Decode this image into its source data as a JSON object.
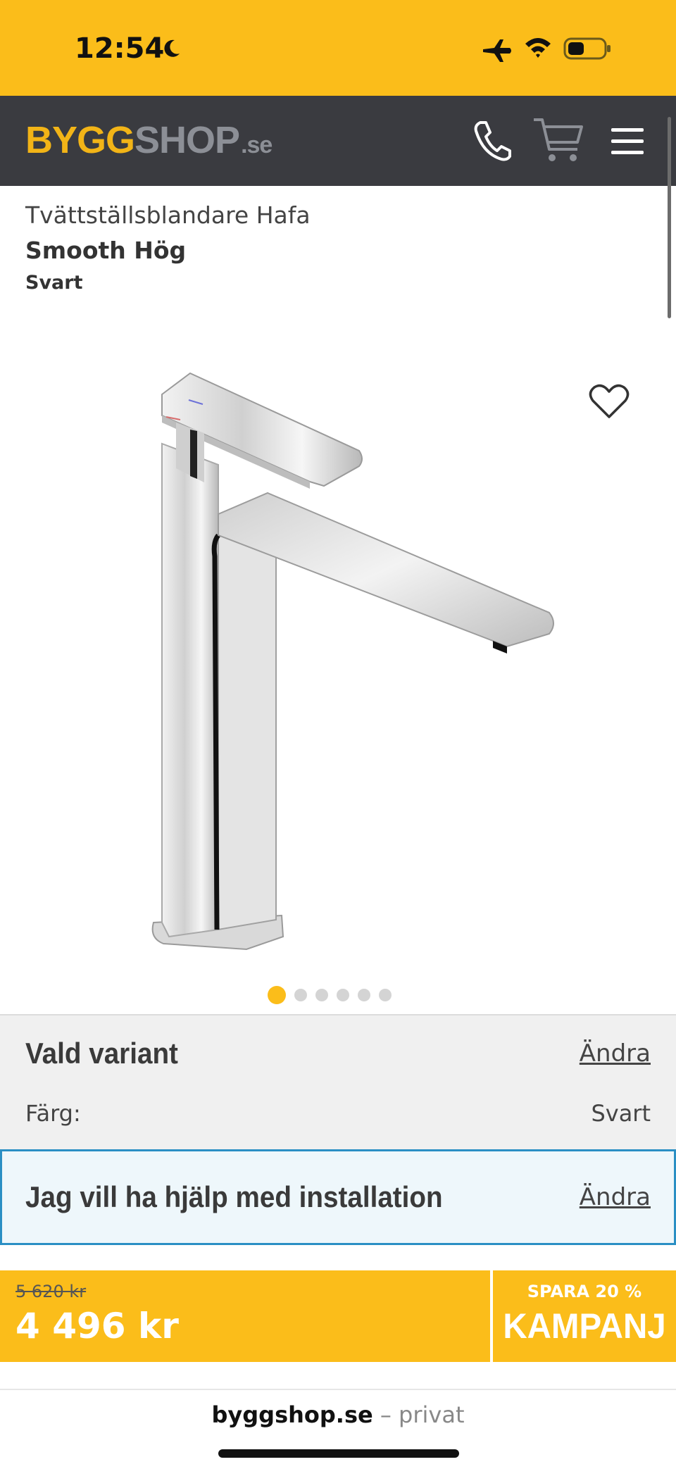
{
  "status_bar": {
    "time": "12:54"
  },
  "header": {
    "logo_part1": "BYGG",
    "logo_part2": "SHOP",
    "logo_part3": ".se"
  },
  "product": {
    "title": "Tvättställsblandare Hafa",
    "model": "Smooth Hög",
    "color": "Svart"
  },
  "carousel": {
    "total_images": 6,
    "active_index": 0
  },
  "variant": {
    "heading": "Vald variant",
    "change_label": "Ändra",
    "color_label": "Färg:",
    "color_value": "Svart"
  },
  "installation": {
    "label": "Jag vill ha hjälp med installation",
    "change_label": "Ändra"
  },
  "price": {
    "old": "5 620 kr",
    "current": "4 496 kr",
    "save_label": "SPARA 20 %",
    "campaign_label": "KAMPANJ"
  },
  "browser": {
    "domain": "byggshop.se",
    "suffix": " – privat"
  },
  "colors": {
    "brand_yellow": "#FBBD1A",
    "header_dark": "#3A3B40",
    "link_blue_border": "#2A8FC4"
  }
}
